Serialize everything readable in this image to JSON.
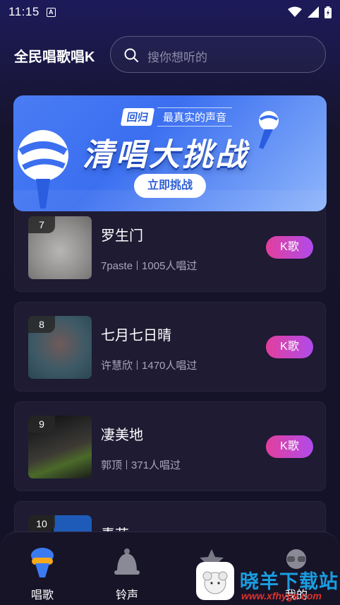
{
  "status_bar": {
    "time": "11:15",
    "notification_letter": "A"
  },
  "header": {
    "app_title": "全民唱歌唱K"
  },
  "search": {
    "placeholder": "搜你想听的"
  },
  "banner": {
    "tag_left": "回归",
    "tag_right": "最真实的声音",
    "headline": "清唱大挑战",
    "button_label": "立即挑战"
  },
  "songs": [
    {
      "rank": "7",
      "title": "罗生门",
      "artist": "7paste",
      "sung": "1005人唱过",
      "button": "K歌"
    },
    {
      "rank": "8",
      "title": "七月七日晴",
      "artist": "许慧欣",
      "sung": "1470人唱过",
      "button": "K歌"
    },
    {
      "rank": "9",
      "title": "凄美地",
      "artist": "郭顶",
      "sung": "371人唱过",
      "button": "K歌"
    },
    {
      "rank": "10",
      "title": "青花",
      "artist": "",
      "sung": "",
      "button": ""
    }
  ],
  "tabs": [
    {
      "label": "唱歌",
      "icon": "microphone-icon",
      "active": true
    },
    {
      "label": "铃声",
      "icon": "bell-icon",
      "active": false
    },
    {
      "label": "",
      "icon": "star-icon",
      "active": false
    },
    {
      "label": "我的",
      "icon": "profile-icon",
      "active": false
    }
  ],
  "watermark": {
    "name": "晓羊下载站",
    "url": "www.xfhygs.com"
  },
  "colors": {
    "accent_pink": "#e23f9c",
    "accent_purple": "#b04bea",
    "banner_blue": "#3b6ff0"
  }
}
